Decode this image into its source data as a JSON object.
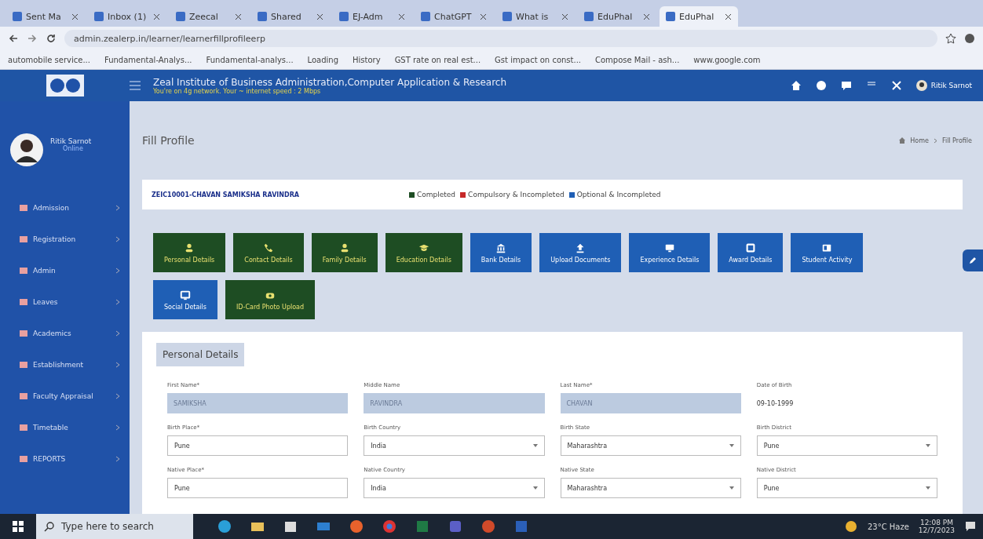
{
  "browser": {
    "tabs": [
      {
        "label": "Sent Ma",
        "selected": false
      },
      {
        "label": "Inbox (1)",
        "selected": false
      },
      {
        "label": "Zeecal",
        "selected": false
      },
      {
        "label": "Shared",
        "selected": false
      },
      {
        "label": "EJ-Adm",
        "selected": false
      },
      {
        "label": "ChatGPT",
        "selected": false
      },
      {
        "label": "What is",
        "selected": false
      },
      {
        "label": "EduPhal",
        "selected": false
      },
      {
        "label": "EduPhal",
        "selected": true
      }
    ],
    "url": "admin.zealerp.in/learner/learnerfillprofileerp",
    "bookmarks": [
      "automobile service...",
      "Fundamental-Analys...",
      "Fundamental-analys...",
      "Loading",
      "History",
      "GST rate on real est...",
      "Gst impact on const...",
      "Compose Mail - ash...",
      "www.google.com"
    ]
  },
  "header": {
    "title": "Zeal Institute of Business Administration,Computer Application & Research",
    "network": "You're on 4g network. Your ~ internet speed : 2 Mbps",
    "user": "Ritik Sarnot"
  },
  "sidebar": {
    "user": "Ritik Sarnot",
    "status": "Online",
    "items": [
      "Admission",
      "Registration",
      "Admin",
      "Leaves",
      "Academics",
      "Establishment",
      "Faculty Appraisal",
      "Timetable",
      "REPORTS"
    ]
  },
  "page": {
    "title": "Fill Profile",
    "breadcrumb": [
      "Home",
      "Fill Profile"
    ]
  },
  "student": "ZEIC10001-CHAVAN SAMIKSHA RAVINDRA",
  "legend": [
    {
      "label": "Completed",
      "color": "#1e4d23"
    },
    {
      "label": "Compulsory & Incompleted",
      "color": "#c62828"
    },
    {
      "label": "Optional & Incompleted",
      "color": "#1f5fb5"
    }
  ],
  "sections": [
    {
      "label": "Personal Details",
      "color": "#1e4d23"
    },
    {
      "label": "Contact Details",
      "color": "#1e4d23"
    },
    {
      "label": "Family Details",
      "color": "#1e4d23"
    },
    {
      "label": "Education Details",
      "color": "#1e4d23"
    },
    {
      "label": "Bank Details",
      "color": "#1f5fb5"
    },
    {
      "label": "Upload Documents",
      "color": "#1f5fb5"
    },
    {
      "label": "Experience Details",
      "color": "#1f5fb5"
    },
    {
      "label": "Award Details",
      "color": "#1f5fb5"
    },
    {
      "label": "Student Activity",
      "color": "#1f5fb5"
    },
    {
      "label": "Social Details",
      "color": "#1f5fb5"
    },
    {
      "label": "ID-Card Photo Upload",
      "color": "#1e4d23"
    }
  ],
  "form": {
    "title": "Personal Details",
    "fields": [
      {
        "label": "First Name*",
        "value": "SAMIKSHA",
        "kind": "readonly"
      },
      {
        "label": "Middle Name",
        "value": "RAVINDRA",
        "kind": "readonly"
      },
      {
        "label": "Last Name*",
        "value": "CHAVAN",
        "kind": "readonly"
      },
      {
        "label": "Date of Birth",
        "value": "09-10-1999",
        "kind": "static"
      },
      {
        "label": "Birth Place*",
        "value": "Pune",
        "kind": "text"
      },
      {
        "label": "Birth Country",
        "value": "India",
        "kind": "select"
      },
      {
        "label": "Birth State",
        "value": "Maharashtra",
        "kind": "select"
      },
      {
        "label": "Birth District",
        "value": "Pune",
        "kind": "select"
      },
      {
        "label": "Native Place*",
        "value": "Pune",
        "kind": "text"
      },
      {
        "label": "Native Country",
        "value": "India",
        "kind": "select"
      },
      {
        "label": "Native State",
        "value": "Maharashtra",
        "kind": "select"
      },
      {
        "label": "Native District",
        "value": "Pune",
        "kind": "select"
      }
    ]
  },
  "taskbar": {
    "search_placeholder": "Type here to search",
    "weather": "23°C Haze",
    "time": "12:08 PM",
    "date": "12/7/2023"
  }
}
